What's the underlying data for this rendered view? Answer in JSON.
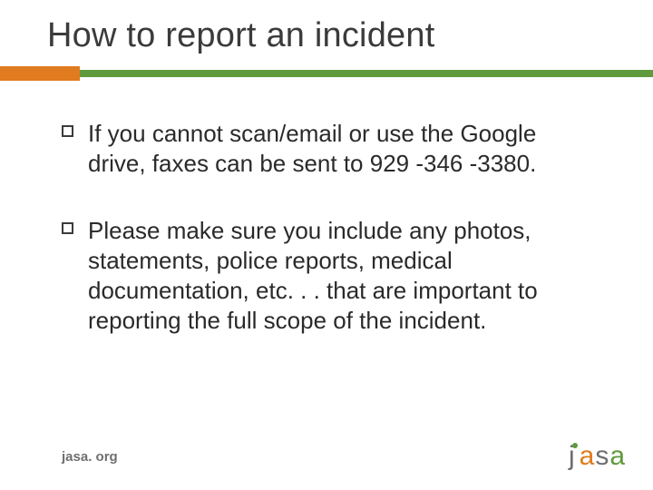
{
  "title": "How to report an incident",
  "bullets": [
    "If you cannot scan/email or use the Google drive, faxes can be sent to 929 -346 -3380.",
    "Please make sure you include any photos, statements, police reports, medical documentation, etc. . . that are important to reporting the full scope of the incident."
  ],
  "footer": "jasa. org",
  "logo": {
    "j": "j",
    "a1": "a",
    "s": "s",
    "a2": "a"
  },
  "colors": {
    "accent_orange": "#e07b1f",
    "accent_green": "#5f9a3c"
  }
}
